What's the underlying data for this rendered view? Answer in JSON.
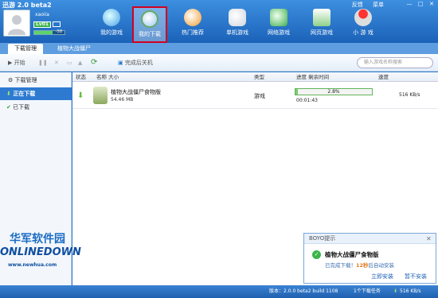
{
  "app": {
    "title": "迅游 2.0 beta2"
  },
  "user": {
    "name": "xaoiia",
    "level": "Lv01",
    "progress_label": "-58",
    "exp_fraction": 0.6
  },
  "top_nav": [
    {
      "label": "我的游戏",
      "icon": "people-icon"
    },
    {
      "label": "我的下载",
      "icon": "download-gear-icon",
      "active": true
    },
    {
      "label": "热门推荐",
      "icon": "globe-icon"
    },
    {
      "label": "单机游戏",
      "icon": "gamepad-icon"
    },
    {
      "label": "网络游戏",
      "icon": "book-icon"
    },
    {
      "label": "网页游戏",
      "icon": "web-page-icon"
    },
    {
      "label": "小 游 戏",
      "icon": "joystick-icon"
    }
  ],
  "window_links": {
    "feedback": "反馈",
    "menu": "菜单"
  },
  "tabs": [
    {
      "label": "下载管理"
    },
    {
      "label": "植物大战僵尸"
    }
  ],
  "toolbar": {
    "start": "开始",
    "shutdown": "完成后关机",
    "search_placeholder": "输入游戏名称搜索"
  },
  "sidebar": {
    "root": "下载管理",
    "downloading": "正在下载",
    "downloaded": "已下载"
  },
  "table": {
    "headers": {
      "status": "状态",
      "name": "名称 大小",
      "type": "类型",
      "progress": "进度 剩余时间",
      "speed": "速度"
    },
    "rows": [
      {
        "name": "植物大战僵尸食物版",
        "size": "54.46 MB",
        "type": "游戏",
        "progress_text": "2.8%",
        "progress": 0.028,
        "remaining": "00:01:43",
        "speed": "516 KB/s"
      }
    ]
  },
  "popup": {
    "title": "BOYO提示",
    "game": "植物大战僵尸食物版",
    "msg_pre": "已完成下载！",
    "countdown": "12秒",
    "msg_post": "后自动安装",
    "install": "立即安装",
    "later": "暂不安装"
  },
  "watermark": {
    "cn": "华军软件园",
    "en": "ONLINEDOWN",
    "url": "www.newhua.com"
  },
  "status": {
    "version": "版本：2.0.0 beta2 build 1108",
    "tasks": "1个下载任务",
    "speed": "516 KB/s"
  },
  "colors": {
    "accent": "#2d7ad0",
    "active_border": "#d4001f",
    "progress": "#7acb6d"
  }
}
